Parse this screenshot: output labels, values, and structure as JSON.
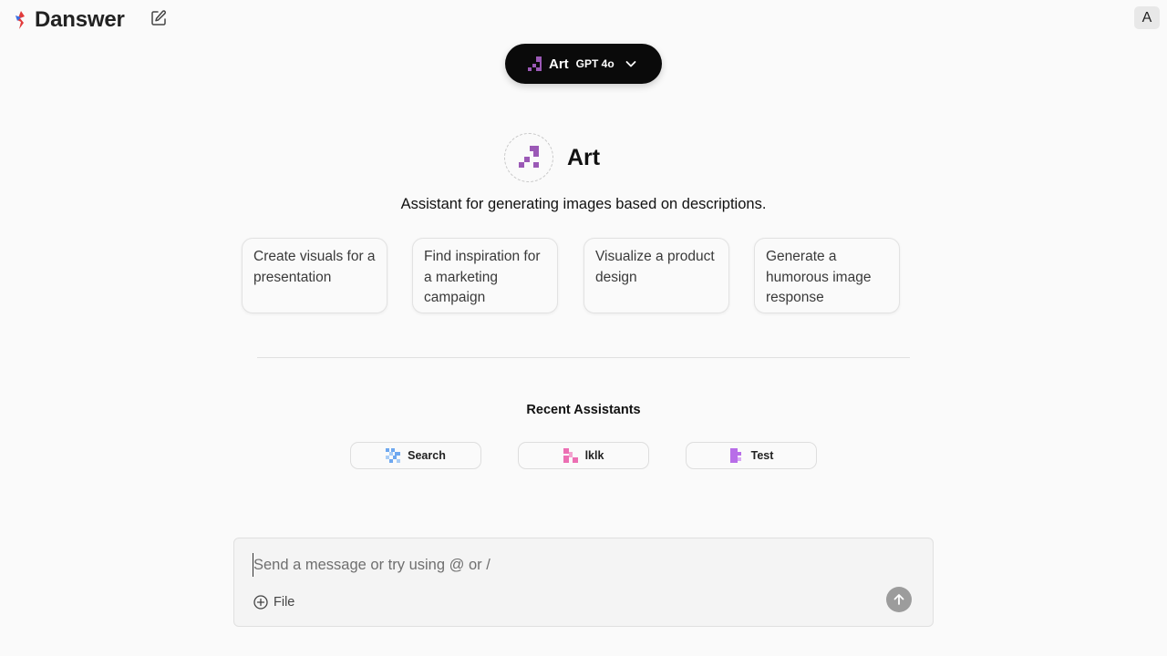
{
  "app": {
    "name": "Danswer"
  },
  "header": {
    "new_chat_icon": "edit-icon",
    "user_initial": "A"
  },
  "model_selector": {
    "assistant": "Art",
    "model": "GPT 4o",
    "chevron_icon": "chevron-down-icon"
  },
  "assistant": {
    "name": "Art",
    "description": "Assistant for generating images based on descriptions.",
    "color": "#9b59b6"
  },
  "starters": [
    {
      "label": "Create visuals for a presentation"
    },
    {
      "label": "Find inspiration for a marketing campaign"
    },
    {
      "label": "Visualize a product design"
    },
    {
      "label": "Generate a humorous image response"
    }
  ],
  "recent": {
    "title": "Recent Assistants",
    "items": [
      {
        "label": "Search",
        "color": "#6ea8f0"
      },
      {
        "label": "lklk",
        "color": "#ec6fb3"
      },
      {
        "label": "Test",
        "color": "#b86de8"
      }
    ]
  },
  "composer": {
    "placeholder": "Send a message or try using @ or /",
    "value": "",
    "file_label": "File",
    "send_icon": "arrow-up-icon"
  }
}
